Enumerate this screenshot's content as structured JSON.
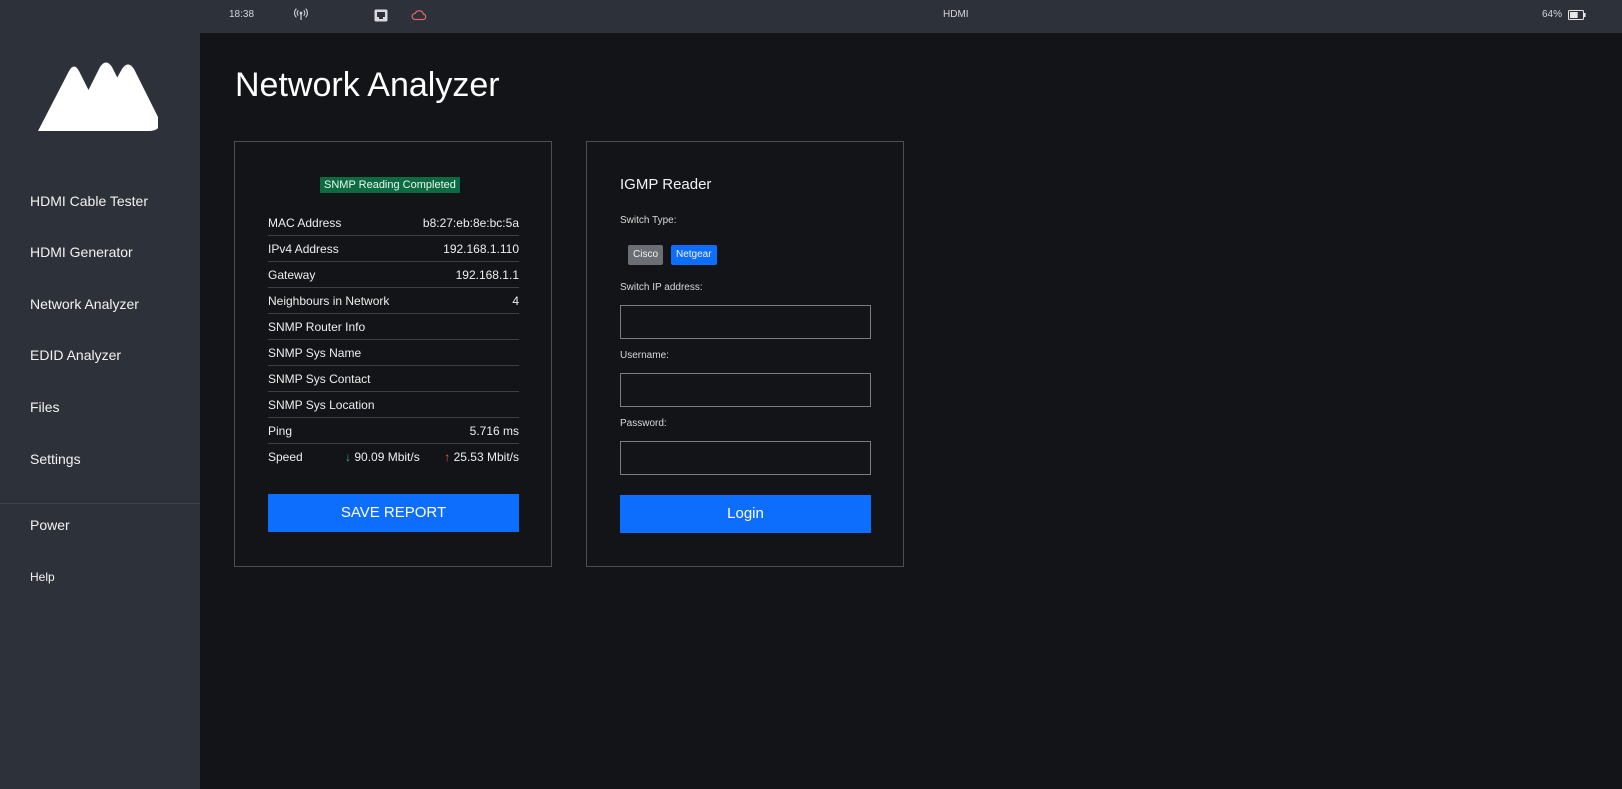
{
  "status_bar": {
    "time": "18:38",
    "center_label": "HDMI",
    "battery_percent": "64%",
    "battery_level": 0.64,
    "icons": [
      "antenna-icon",
      "ethernet-icon",
      "cloud-icon",
      "battery-icon"
    ]
  },
  "sidebar": {
    "logo": "brand-logo",
    "items": [
      {
        "label": "HDMI Cable Tester"
      },
      {
        "label": "HDMI Generator"
      },
      {
        "label": "Network Analyzer"
      },
      {
        "label": "EDID Analyzer"
      },
      {
        "label": "Files"
      },
      {
        "label": "Settings"
      }
    ],
    "power": "Power",
    "help": "Help"
  },
  "page": {
    "title": "Network Analyzer"
  },
  "network_card": {
    "status_badge": "SNMP Reading Completed",
    "rows": [
      {
        "label": "MAC Address",
        "value": "b8:27:eb:8e:bc:5a"
      },
      {
        "label": "IPv4 Address",
        "value": "192.168.1.110"
      },
      {
        "label": "Gateway",
        "value": "192.168.1.1"
      },
      {
        "label": "Neighbours in Network",
        "value": "4"
      },
      {
        "label": "SNMP Router Info",
        "value": ""
      },
      {
        "label": "SNMP Sys Name",
        "value": ""
      },
      {
        "label": "SNMP Sys Contact",
        "value": ""
      },
      {
        "label": "SNMP Sys Location",
        "value": ""
      },
      {
        "label": "Ping",
        "value": "5.716 ms"
      }
    ],
    "speed": {
      "label": "Speed",
      "download": "90.09 Mbit/s",
      "upload": "25.53 Mbit/s"
    },
    "save_button": "SAVE REPORT"
  },
  "igmp_card": {
    "title": "IGMP Reader",
    "switch_type_label": "Switch Type:",
    "switch_types": [
      "Cisco",
      "Netgear"
    ],
    "selected_switch_type": "Netgear",
    "switch_ip_label": "Switch IP address:",
    "switch_ip_value": "",
    "username_label": "Username:",
    "username_value": "",
    "password_label": "Password:",
    "password_value": "",
    "login_button": "Login"
  },
  "colors": {
    "accent": "#0d6efd",
    "status_success": "#0d6b43",
    "download_arrow": "#2ec27e",
    "upload_arrow": "#ff5a36",
    "sidebar_bg": "#2d3139",
    "main_bg": "#121418"
  }
}
